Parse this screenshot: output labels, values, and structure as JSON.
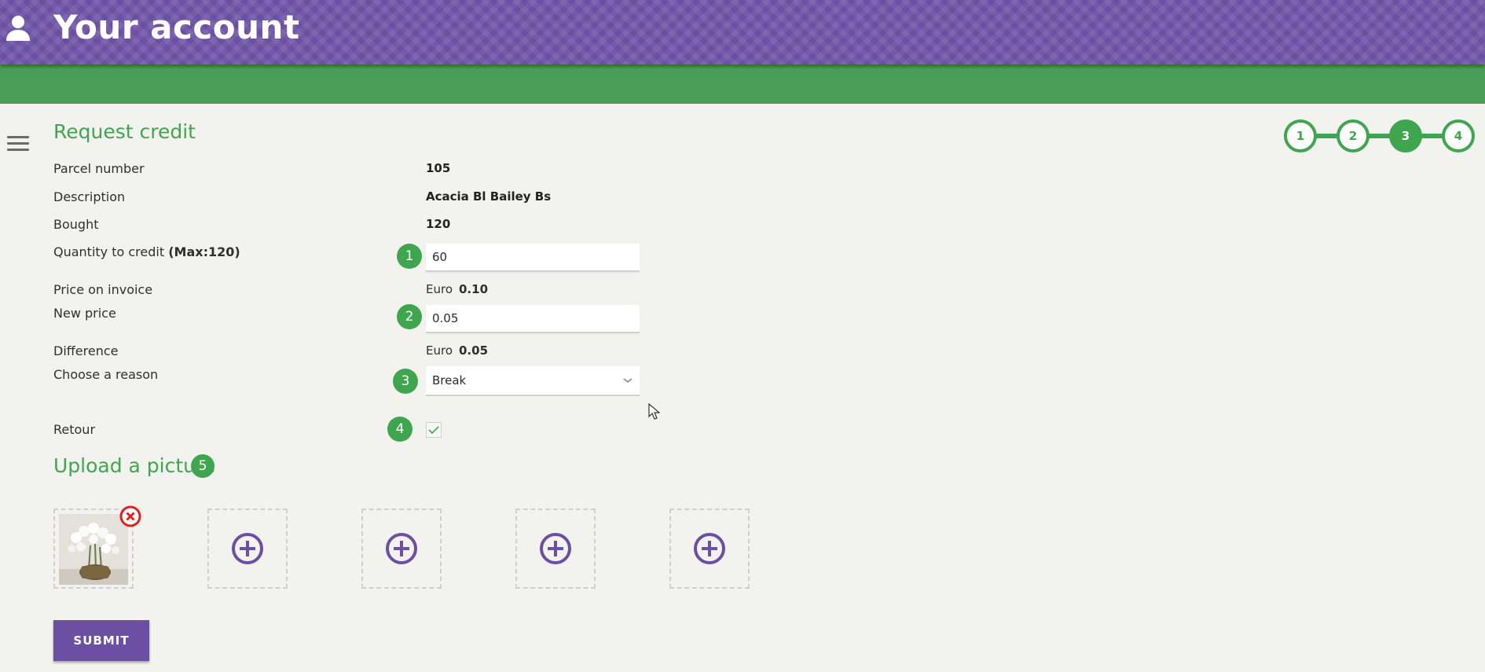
{
  "header": {
    "title": "Your account",
    "icon": "user-icon"
  },
  "colors": {
    "brand_purple": "#6a4fa3",
    "accent_green": "#3fa54f",
    "bar_green": "#4a9e57",
    "remove_red": "#e0201e"
  },
  "stepper": {
    "steps": [
      "1",
      "2",
      "3",
      "4"
    ],
    "active_step": "3"
  },
  "form": {
    "title": "Request credit",
    "parcel": {
      "label": "Parcel number",
      "value": "105"
    },
    "description": {
      "label": "Description",
      "value": "Acacia Bl Bailey Bs"
    },
    "bought": {
      "label": "Bought",
      "value": "120"
    },
    "quantity": {
      "label": "Quantity to credit",
      "max_note": "(Max:120)",
      "badge": "1",
      "value": "60"
    },
    "price_invoice": {
      "label": "Price on invoice",
      "currency": "Euro",
      "value": "0.10"
    },
    "new_price": {
      "label": "New price",
      "badge": "2",
      "value": "0.05"
    },
    "difference": {
      "label": "Difference",
      "currency": "Euro",
      "value": "0.05"
    },
    "reason": {
      "label": "Choose a reason",
      "badge": "3",
      "value": "Break"
    },
    "retour": {
      "label": "Retour",
      "badge": "4",
      "checked": true
    }
  },
  "upload": {
    "title": "Upload a picture",
    "badge": "5",
    "slots": [
      {
        "state": "filled",
        "icon": "orchid-photo"
      },
      {
        "state": "empty",
        "icon": "add-circle-icon"
      },
      {
        "state": "empty",
        "icon": "add-circle-icon"
      },
      {
        "state": "empty",
        "icon": "add-circle-icon"
      },
      {
        "state": "empty",
        "icon": "add-circle-icon"
      }
    ]
  },
  "submit_label": "SUBMIT"
}
